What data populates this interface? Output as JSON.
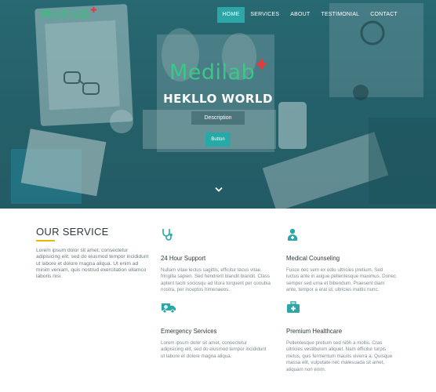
{
  "nav": {
    "logo": "Medilab",
    "items": [
      {
        "label": "HOME",
        "active": true
      },
      {
        "label": "SERVICES",
        "active": false
      },
      {
        "label": "ABOUT",
        "active": false
      },
      {
        "label": "TESTIMONIAL",
        "active": false
      },
      {
        "label": "CONTACT",
        "active": false
      }
    ]
  },
  "hero": {
    "logo": "Medilab",
    "title": "HEKLLO WORLD",
    "description": "Description",
    "button": "Button"
  },
  "service": {
    "heading": "OUR SERVICE",
    "intro": "Lorem ipsum dolor sit amet, consectetur adipisicing elit, sed do eiusmod tempor incididunt ut labore et dolore magna aliqua. Ut enim ad minim veniam, quis nostrud exercitation ullamco laboris nisi.",
    "cards": [
      {
        "icon": "stethoscope-icon",
        "title": "24 Hour Support",
        "text": "Nullam vitae lectus sagittis, efficitur lacus vitae, fringilla sapien. Sed hendrerit blandit blandit. Class aptent taciti sociosqu ad litora torquent per conubia nostra, per inceptos himenaeos."
      },
      {
        "icon": "doctor-icon",
        "title": "Medical Counseling",
        "text": "Fusce nec sem ex odio ultricies pretium. Sed luctus ante in augue pellentesque maximus. Donec semper sed urna et bibendum. Praesent diam ante, tempor a erat id, ultricies mattis nunc."
      },
      {
        "icon": "ambulance-icon",
        "title": "Emergency Services",
        "text": "Lorem ipsum dolor sit amet, consectetur adipisicing elit, sed do eiusmod tempor incididunt ut labore et dolore magna aliqua."
      },
      {
        "icon": "medkit-icon",
        "title": "Premium Healthcare",
        "text": "Pellentesque pretium sed nibh a mollis. Cras ultricies vestibulum aliquet. Nam efficitur turpis metus, quis fermentum mauris viverra a. Quisque massa elit, vulputate nec malesuada sit amet, aliquam non enim."
      }
    ]
  },
  "colors": {
    "accent": "#2aa7a6",
    "logo_green": "#3bc78a",
    "logo_plus": "#e23b3b",
    "rule": "#e6b800",
    "icon": "#2aa7a6"
  }
}
